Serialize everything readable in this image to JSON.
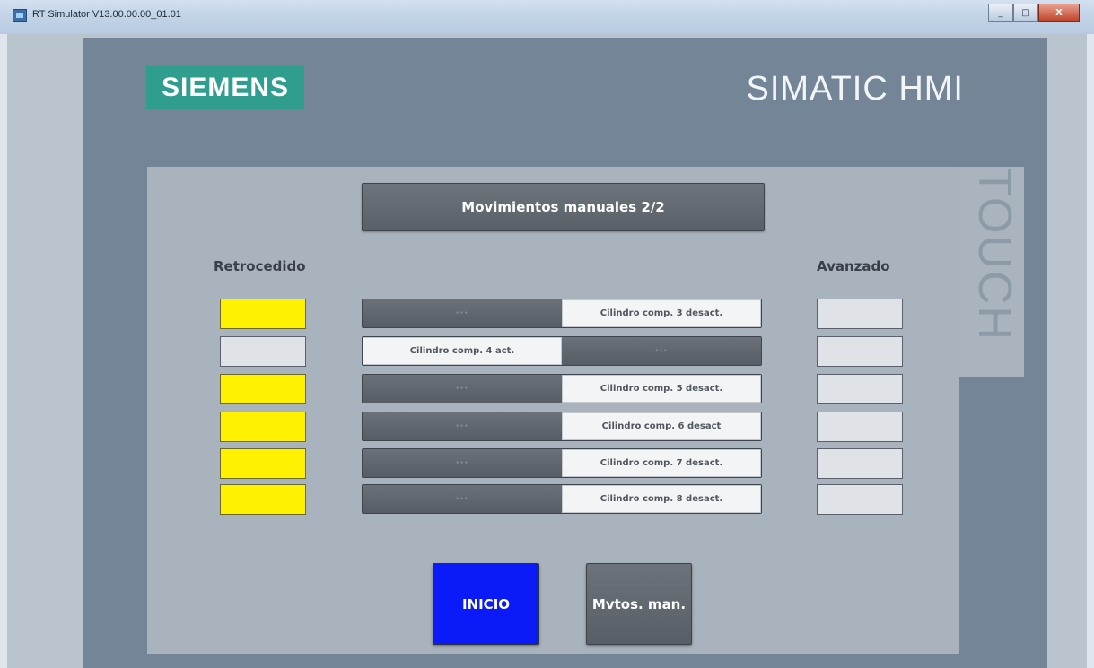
{
  "window": {
    "title": "RT Simulator V13.00.00.00_01.01",
    "buttons": [
      "_",
      "□",
      "X"
    ]
  },
  "device": {
    "brand": "SIEMENS",
    "model": "SIMATIC HMI",
    "side_label": "TOUCH",
    "brand_color": "#2f9e8e"
  },
  "screen": {
    "title": "Movimientos manuales 2/2",
    "left_header": "Retrocedido",
    "right_header": "Avanzado",
    "rows": [
      {
        "retrocedido": true,
        "avanzado": false,
        "switch_on": false,
        "switch_label": "Cilindro comp. 3 desact.",
        "switch_other": "···"
      },
      {
        "retrocedido": false,
        "avanzado": false,
        "switch_on": true,
        "switch_label": "Cilindro comp. 4 act.",
        "switch_other": "···"
      },
      {
        "retrocedido": true,
        "avanzado": false,
        "switch_on": false,
        "switch_label": "Cilindro comp. 5 desact.",
        "switch_other": "···"
      },
      {
        "retrocedido": true,
        "avanzado": false,
        "switch_on": false,
        "switch_label": "Cilindro comp. 6 desact",
        "switch_other": "···"
      },
      {
        "retrocedido": true,
        "avanzado": false,
        "switch_on": false,
        "switch_label": "Cilindro comp. 7 desact.",
        "switch_other": "···"
      },
      {
        "retrocedido": true,
        "avanzado": false,
        "switch_on": false,
        "switch_label": "Cilindro comp. 8 desact.",
        "switch_other": "···"
      }
    ],
    "nav": {
      "inicio_label": "INICIO",
      "mvtos_label": "Mvtos. man."
    }
  },
  "colors": {
    "indicator_on": "#fff200",
    "indicator_off": "#dfe2e6",
    "inicio_button": "#0a1bf7"
  }
}
